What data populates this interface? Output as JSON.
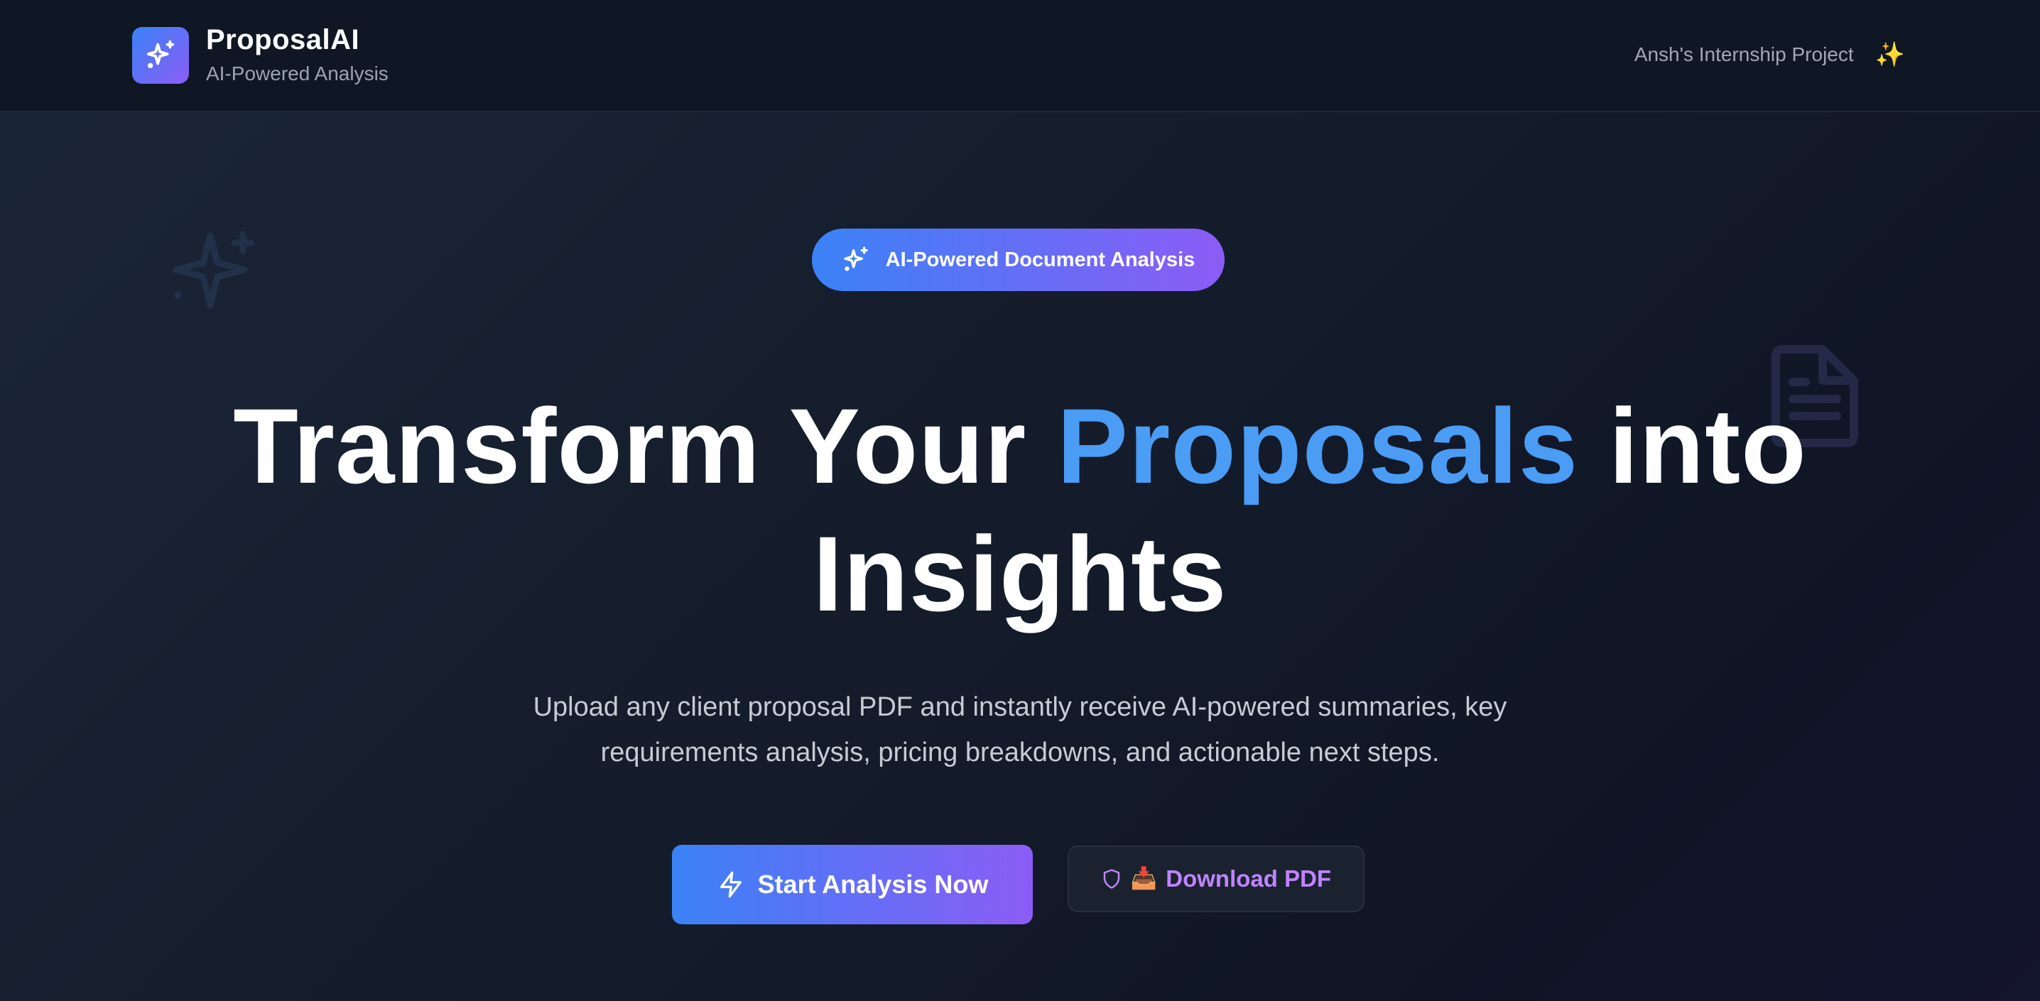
{
  "header": {
    "brand_name": "ProposalAI",
    "brand_tagline": "AI-Powered Analysis",
    "project_label": "Ansh's Internship Project",
    "project_emoji": "✨"
  },
  "hero": {
    "badge_label": "AI-Powered Document Analysis",
    "title_part1": "Transform Your ",
    "title_accent": "Proposals",
    "title_part2": " into Insights",
    "subtitle": "Upload any client proposal PDF and instantly receive AI-powered summaries, key requirements analysis, pricing breakdowns, and actionable next steps."
  },
  "actions": {
    "primary_label": "Start Analysis Now",
    "primary_icon": "lightning-icon",
    "secondary_label": "Download PDF",
    "secondary_emoji": "📥",
    "secondary_icon": "shield-icon"
  },
  "colors": {
    "accent_blue": "#3b82f6",
    "accent_purple": "#8b5cf6",
    "title_accent": "#4a9cf5",
    "secondary_text": "#c084fc",
    "background": "#151d2c"
  }
}
